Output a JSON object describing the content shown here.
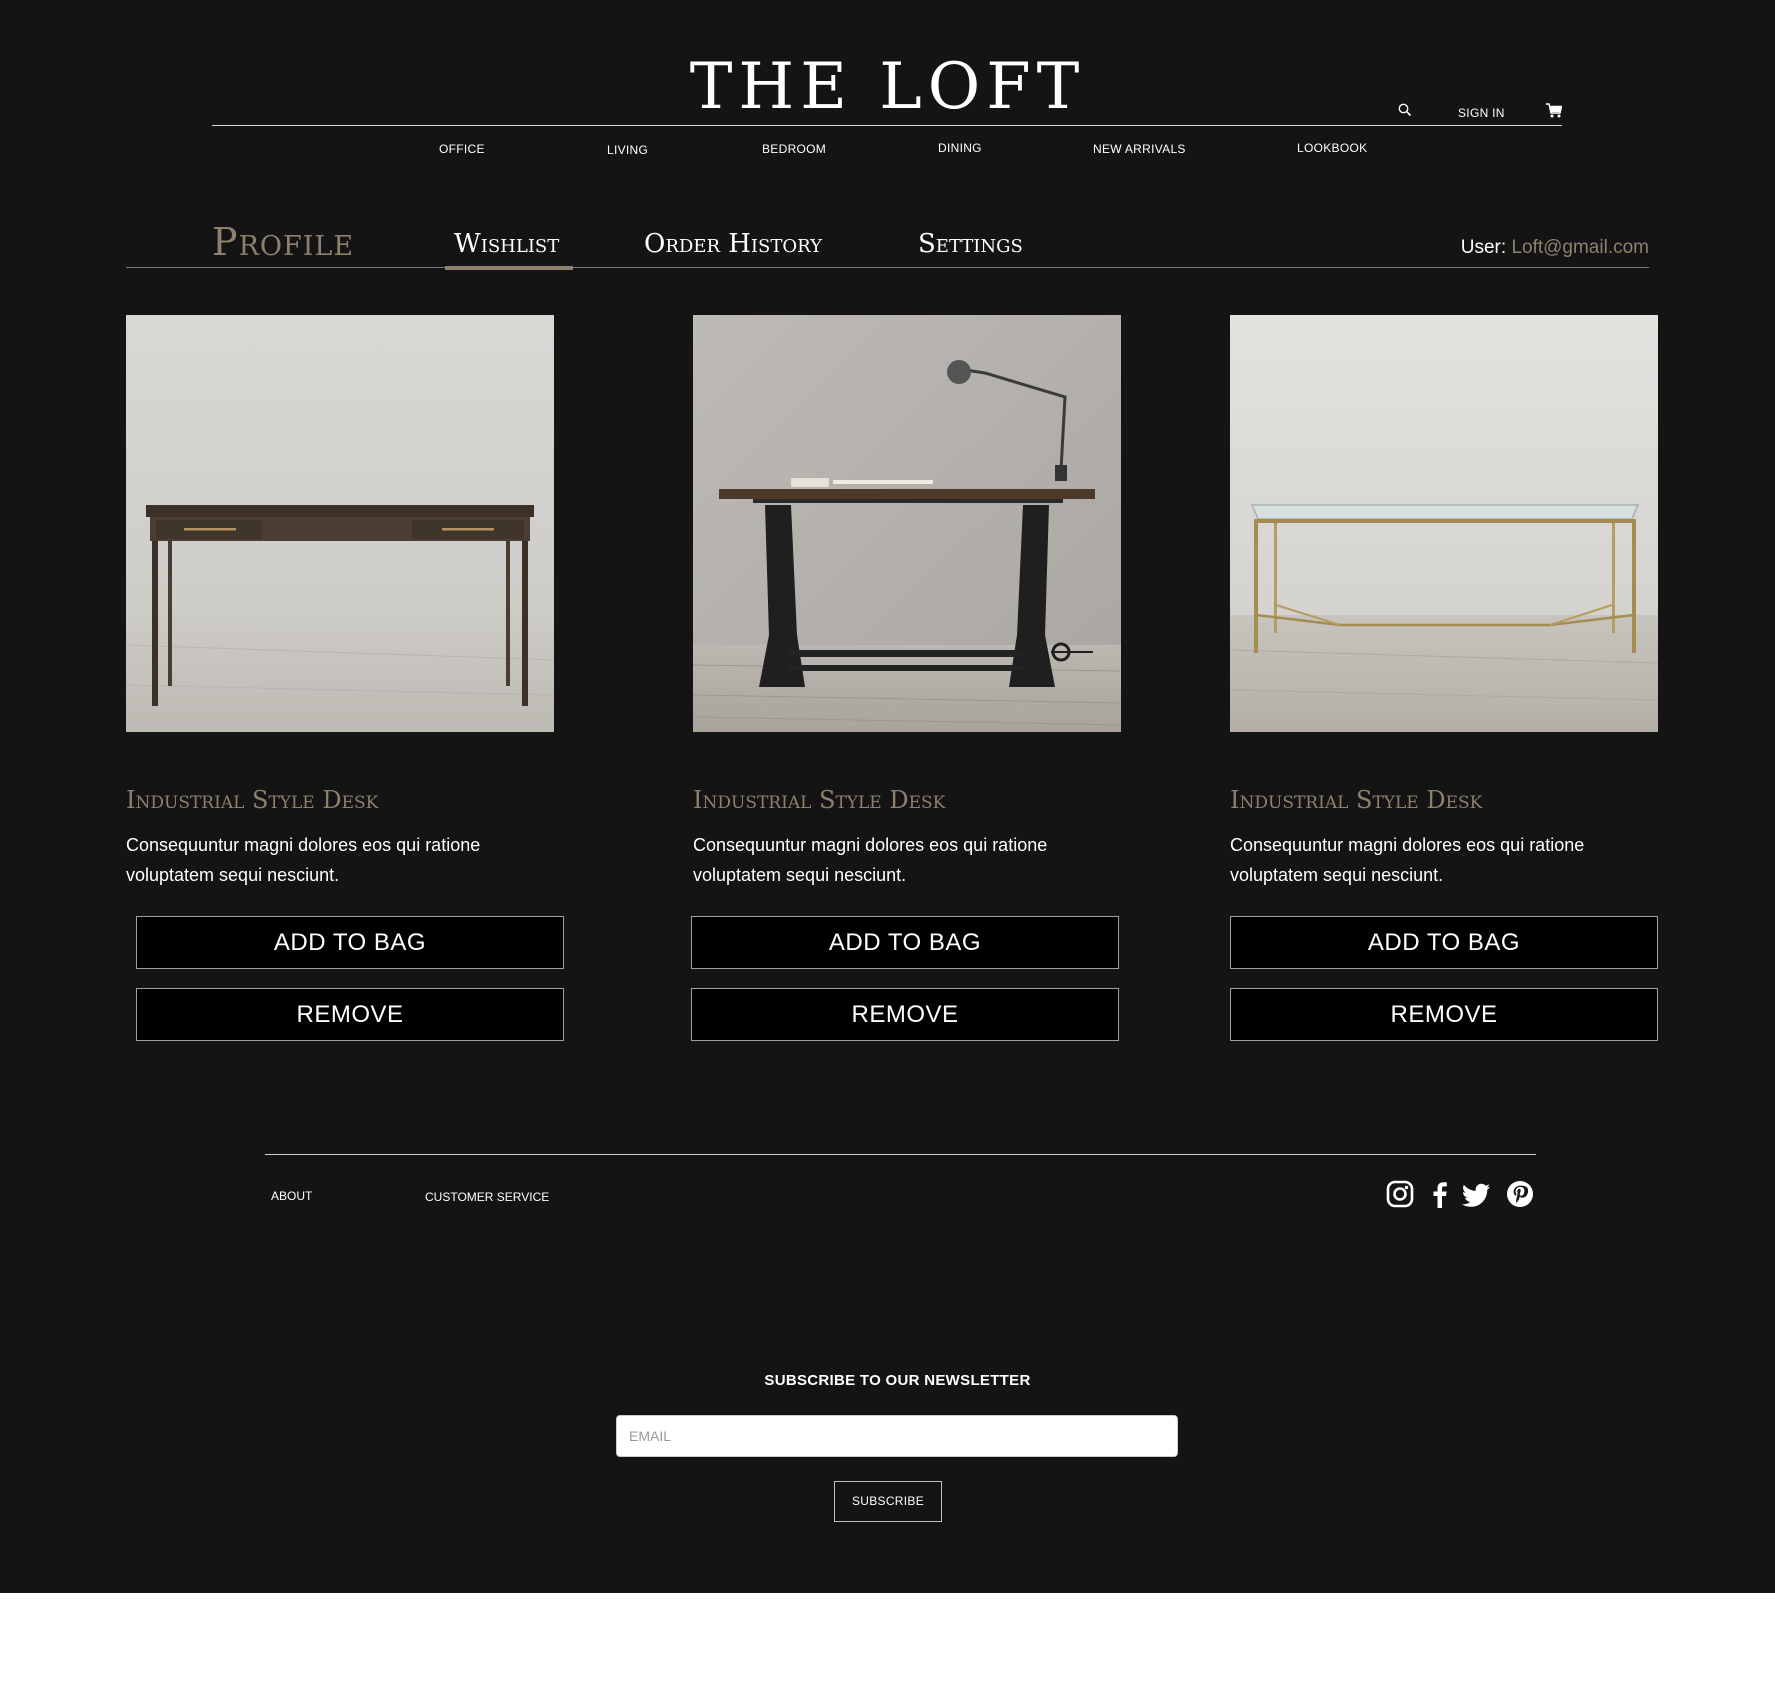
{
  "brand": {
    "logo_text": "THE LOFT"
  },
  "header": {
    "signin_label": "SIGN IN",
    "nav": [
      "OFFICE",
      "LIVING",
      "BEDROOM",
      "DINING",
      "NEW ARRIVALS",
      "LOOKBOOK"
    ]
  },
  "profile": {
    "tabs": {
      "profile": "Profile",
      "wishlist": "Wishlist",
      "orders": "Order History",
      "settings": "Settings"
    },
    "active_tab": "Wishlist",
    "user_label": "User:",
    "user_email": "Loft@gmail.com"
  },
  "products": [
    {
      "title": "Industrial Style Desk",
      "description": "Consequuntur magni dolores eos qui ratione voluptatem sequi nesciunt.",
      "add_label": "ADD TO BAG",
      "remove_label": "REMOVE"
    },
    {
      "title": "Industrial Style Desk",
      "description": "Consequuntur magni dolores eos qui ratione voluptatem sequi nesciunt.",
      "add_label": "ADD TO BAG",
      "remove_label": "REMOVE"
    },
    {
      "title": "Industrial Style Desk",
      "description": "Consequuntur magni dolores eos qui ratione voluptatem sequi nesciunt.",
      "add_label": "ADD TO BAG",
      "remove_label": "REMOVE"
    }
  ],
  "footer": {
    "links": [
      "ABOUT",
      "CUSTOMER SERVICE"
    ],
    "social": [
      "instagram-icon",
      "facebook-icon",
      "twitter-icon",
      "pinterest-icon"
    ]
  },
  "newsletter": {
    "heading": "SUBSCRIBE TO OUR NEWSLETTER",
    "email_placeholder": "EMAIL",
    "subscribe_label": "SUBSCRIBE"
  },
  "colors": {
    "background": "#141414",
    "accent": "#8d806d",
    "button_bg": "#000000"
  }
}
